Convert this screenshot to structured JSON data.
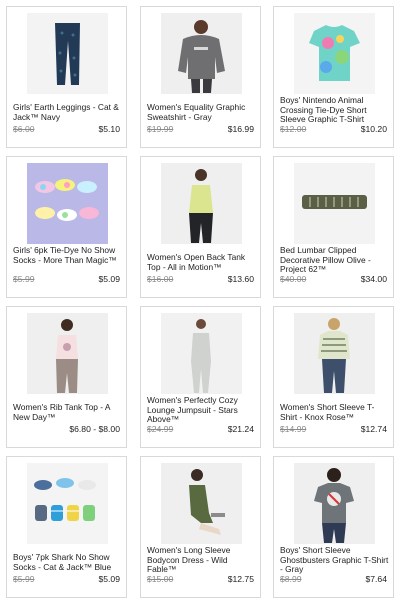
{
  "products": [
    {
      "title": "Girls' Earth Leggings - Cat & Jack™ Navy",
      "original_price": "$6.00",
      "sale_price": "$5.10",
      "image_icon": "leggings-image"
    },
    {
      "title": "Women's Equality Graphic Sweatshirt - Gray",
      "original_price": "$19.99",
      "sale_price": "$16.99",
      "image_icon": "sweatshirt-image"
    },
    {
      "title": "Boys' Nintendo Animal Crossing Tie-Dye Short Sleeve Graphic T-Shirt",
      "original_price": "$12.00",
      "sale_price": "$10.20",
      "image_icon": "tie-dye-tshirt-image"
    },
    {
      "title": "Girls' 6pk Tie-Dye No Show Socks - More Than Magic™",
      "original_price": "$5.99",
      "sale_price": "$5.09",
      "image_icon": "socks-image"
    },
    {
      "title": "Women's Open Back Tank Top - All in Motion™",
      "original_price": "$16.00",
      "sale_price": "$13.60",
      "image_icon": "tank-top-image"
    },
    {
      "title": "Bed Lumbar Clipped Decorative Pillow Olive - Project 62™",
      "original_price": "$40.00",
      "sale_price": "$34.00",
      "image_icon": "pillow-image"
    },
    {
      "title": "Women's Rib Tank Top - A New Day™",
      "original_price": "",
      "sale_price": "$6.80 - $8.00",
      "image_icon": "rib-tank-image"
    },
    {
      "title": "Women's Perfectly Cozy Lounge Jumpsuit - Stars Above™",
      "original_price": "$24.99",
      "sale_price": "$21.24",
      "image_icon": "jumpsuit-image"
    },
    {
      "title": "Women's Short Sleeve T-Shirt - Knox Rose™",
      "original_price": "$14.99",
      "sale_price": "$12.74",
      "image_icon": "tshirt-image"
    },
    {
      "title": "Boys' 7pk Shark No Show Socks - Cat & Jack™ Blue",
      "original_price": "$5.99",
      "sale_price": "$5.09",
      "image_icon": "shark-socks-image"
    },
    {
      "title": "Women's Long Sleeve Bodycon Dress - Wild Fable™",
      "original_price": "$15.00",
      "sale_price": "$12.75",
      "image_icon": "dress-image"
    },
    {
      "title": "Boys' Short Sleeve Ghostbusters Graphic T-Shirt - Gray",
      "original_price": "$8.99",
      "sale_price": "$7.64",
      "image_icon": "ghostbusters-tshirt-image"
    }
  ]
}
